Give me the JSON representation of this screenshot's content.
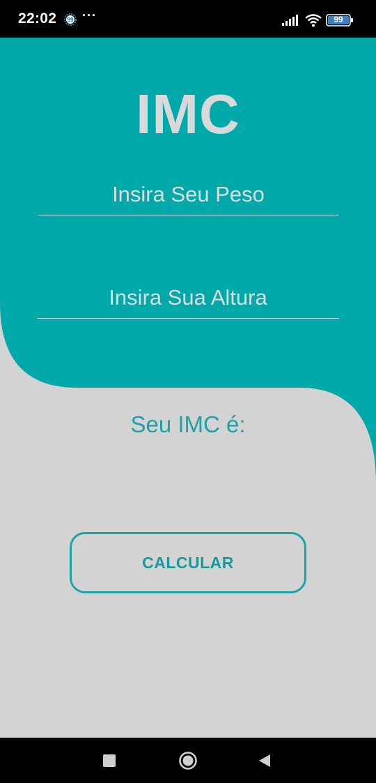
{
  "status_bar": {
    "time": "22:02",
    "notification_badge": "99",
    "more_dots": "···",
    "battery_level": "99"
  },
  "app": {
    "title": "IMC",
    "weight_placeholder": "Insira Seu Peso",
    "height_placeholder": "Insira Sua Altura",
    "result_label": "Seu IMC é:",
    "calculate_button": "CALCULAR"
  },
  "colors": {
    "accent_teal": "#00a8a8",
    "background": "#d3d3d3",
    "title_text": "#d9d9d9",
    "result_text": "#1aa3a8"
  },
  "icons": {
    "status_badge": "badge-99-icon",
    "signal": "signal-icon",
    "wifi": "wifi-icon",
    "battery": "battery-icon",
    "nav_recent": "square-recent-apps-icon",
    "nav_home": "circle-home-icon",
    "nav_back": "triangle-back-icon"
  }
}
